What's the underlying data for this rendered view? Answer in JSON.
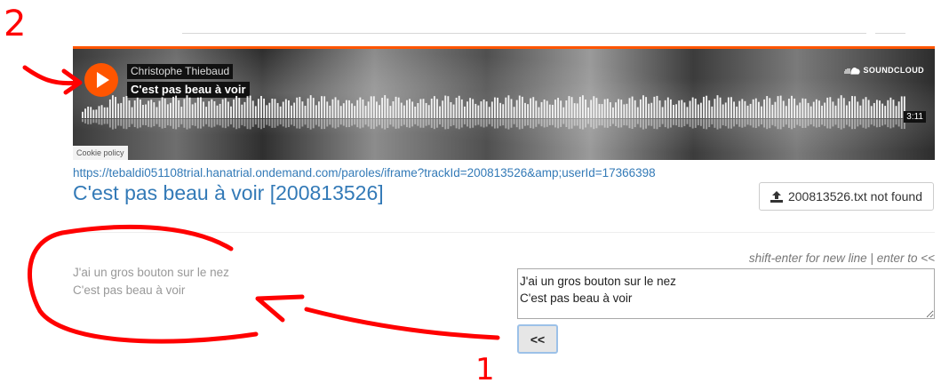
{
  "player": {
    "artist": "Christophe Thiebaud",
    "track_title": "C'est pas beau à voir",
    "brand": "SOUNDCLOUD",
    "duration": "3:11",
    "cookie_policy": "Cookie policy",
    "accent_color": "#ff5500"
  },
  "page": {
    "iframe_url": "https://tebaldi051108trial.hanatrial.ondemand.com/paroles/iframe?trackId=200813526&amp;userId=17366398",
    "title": "C'est pas beau à voir [200813526]",
    "file_button_label": "200813526.txt not found",
    "file_button_icon": "upload-icon"
  },
  "lyrics": {
    "preview_lines": [
      "J'ai un gros bouton sur le nez",
      "C'est pas beau à voir"
    ],
    "hint": "shift-enter for new line | enter to <<",
    "input_value": "J'ai un gros bouton sur le nez\nC'est pas beau à voir",
    "apply_button_label": "<<"
  },
  "annotations": {
    "label_1": "1",
    "label_2": "2",
    "color": "#ff0000"
  }
}
